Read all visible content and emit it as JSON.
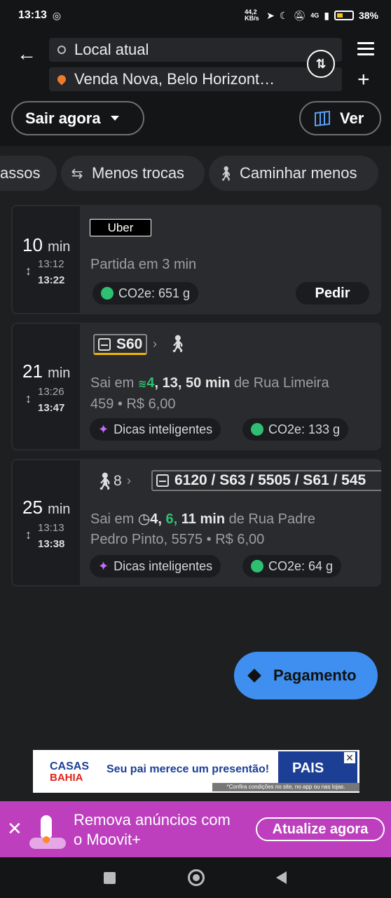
{
  "status_bar": {
    "time": "13:13",
    "net_speed": "44,2 KB/s",
    "network": "4G",
    "battery": "38%"
  },
  "header": {
    "origin": "Local atual",
    "destination": "Venda Nova, Belo Horizont…",
    "leave_label": "Sair agora",
    "view_label": "Ver"
  },
  "chips": [
    "assos",
    "Menos trocas",
    "Caminhar menos"
  ],
  "routes": [
    {
      "duration": "10",
      "unit": "min",
      "depart": "13:12",
      "arrive": "13:22",
      "provider": "Uber",
      "info": "Partida em 3 min",
      "co2": "CO2e: 651 g",
      "action": "Pedir"
    },
    {
      "duration": "21",
      "unit": "min",
      "depart": "13:26",
      "arrive": "13:47",
      "line": "S60",
      "prefix": "Sai em",
      "times_green": "4",
      "times_rest": "13, 50",
      "min_word": "min",
      "from": "de Rua Limeira",
      "address_line2": "459 • R$ 6,00",
      "tips": "Dicas inteligentes",
      "co2": "CO2e: 133 g"
    },
    {
      "duration": "25",
      "unit": "min",
      "depart": "13:13",
      "arrive": "13:38",
      "walk_min": "8",
      "lines": "6120 / S63 / 5505 / S61 / 545",
      "prefix": "Sai em",
      "time_a": "4,",
      "time_green": "6,",
      "time_b": "11",
      "min_word": "min",
      "from": "de Rua Padre",
      "address_line2": "Pedro Pinto, 5575 • R$ 6,00",
      "tips": "Dicas inteligentes",
      "co2": "CO2e: 64 g"
    }
  ],
  "fab": {
    "label": "Pagamento"
  },
  "ad": {
    "brand_top": "CASAS",
    "brand_bottom": "BAHIA",
    "message": "Seu pai merece um presentão!",
    "promo": "PAIS",
    "fine_print": "*Confira condições no site, no app ou nas lojas."
  },
  "promo_bar": {
    "text_line1": "Remova anúncios com",
    "text_line2": "o Moovit+",
    "button": "Atualize agora"
  },
  "colors": {
    "accent": "#3f8ff0",
    "promo": "#bd3fbe",
    "green": "#2fbf71",
    "spark": "#c56bff",
    "origin_pin": "#f07a2c"
  }
}
